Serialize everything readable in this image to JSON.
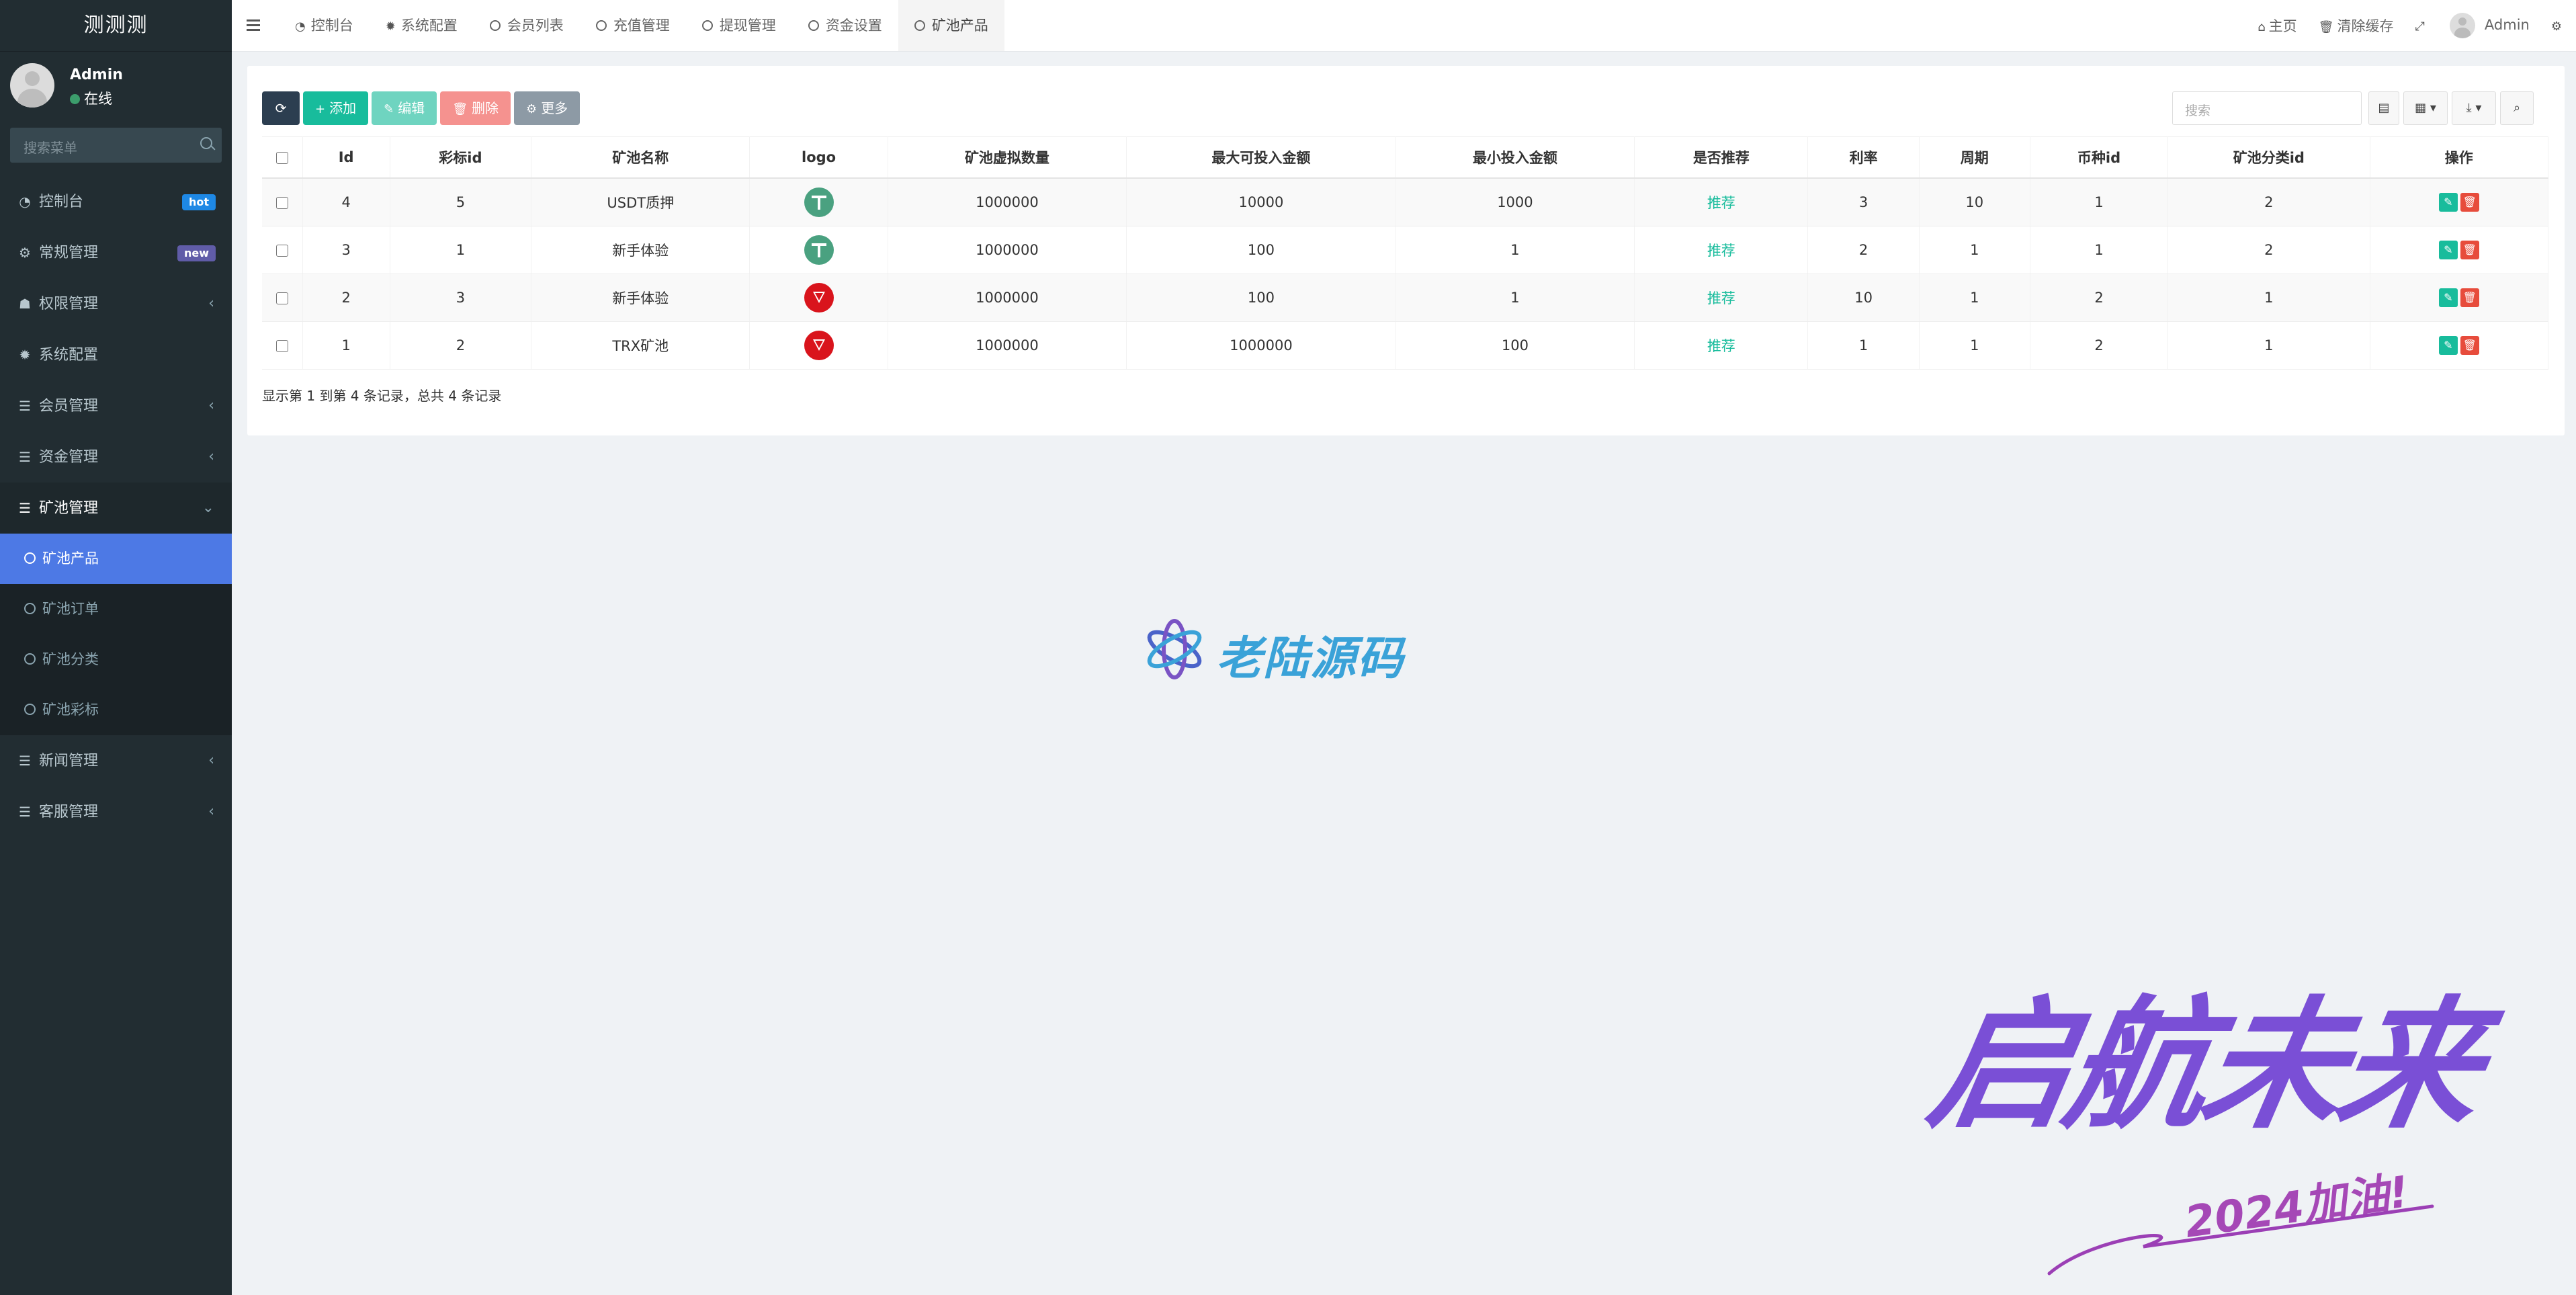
{
  "app": {
    "title": "测测测"
  },
  "user": {
    "name": "Admin",
    "status": "在线"
  },
  "sidebar": {
    "search_placeholder": "搜索菜单",
    "items": [
      {
        "label": "控制台",
        "icon": "dashboard-icon",
        "badge": "hot",
        "badge_color": "#1e88e5"
      },
      {
        "label": "常规管理",
        "icon": "cogs-icon",
        "badge": "new",
        "badge_color": "#605ca8"
      },
      {
        "label": "权限管理",
        "icon": "group-icon",
        "caret": "‹"
      },
      {
        "label": "系统配置",
        "icon": "gear-icon"
      },
      {
        "label": "会员管理",
        "icon": "list-icon",
        "caret": "‹"
      },
      {
        "label": "资金管理",
        "icon": "list-icon",
        "caret": "‹"
      },
      {
        "label": "矿池管理",
        "icon": "list-icon",
        "caret": "⌄",
        "open": true,
        "children": [
          {
            "label": "矿池产品",
            "active": true
          },
          {
            "label": "矿池订单"
          },
          {
            "label": "矿池分类"
          },
          {
            "label": "矿池彩标"
          }
        ]
      },
      {
        "label": "新闻管理",
        "icon": "list-icon",
        "caret": "‹"
      },
      {
        "label": "客服管理",
        "icon": "list-icon",
        "caret": "‹"
      }
    ]
  },
  "topbar": {
    "tabs": [
      {
        "label": "控制台",
        "icon": "dashboard-icon"
      },
      {
        "label": "系统配置",
        "icon": "gear-icon"
      },
      {
        "label": "会员列表",
        "icon": "circle-icon"
      },
      {
        "label": "充值管理",
        "icon": "circle-icon"
      },
      {
        "label": "提现管理",
        "icon": "circle-icon"
      },
      {
        "label": "资金设置",
        "icon": "circle-icon"
      },
      {
        "label": "矿池产品",
        "icon": "circle-icon",
        "active": true
      }
    ],
    "home": "主页",
    "clear_cache": "清除缓存",
    "user": "Admin"
  },
  "toolbar": {
    "add": "添加",
    "edit": "编辑",
    "delete": "删除",
    "more": "更多",
    "search_placeholder": "搜索"
  },
  "table": {
    "columns": [
      "Id",
      "彩标id",
      "矿池名称",
      "logo",
      "矿池虚拟数量",
      "最大可投入金额",
      "最小投入金额",
      "是否推荐",
      "利率",
      "周期",
      "币种id",
      "矿池分类id",
      "操作"
    ],
    "rows": [
      {
        "id": "4",
        "tag_id": "5",
        "name": "USDT质押",
        "logo": "usdt",
        "virtual_qty": "1000000",
        "max_invest": "10000",
        "min_invest": "1000",
        "recommend": "推荐",
        "rate": "3",
        "period": "10",
        "currency_id": "1",
        "category_id": "2"
      },
      {
        "id": "3",
        "tag_id": "1",
        "name": "新手体验",
        "logo": "usdt",
        "virtual_qty": "1000000",
        "max_invest": "100",
        "min_invest": "1",
        "recommend": "推荐",
        "rate": "2",
        "period": "1",
        "currency_id": "1",
        "category_id": "2"
      },
      {
        "id": "2",
        "tag_id": "3",
        "name": "新手体验",
        "logo": "trx",
        "virtual_qty": "1000000",
        "max_invest": "100",
        "min_invest": "1",
        "recommend": "推荐",
        "rate": "10",
        "period": "1",
        "currency_id": "2",
        "category_id": "1"
      },
      {
        "id": "1",
        "tag_id": "2",
        "name": "TRX矿池",
        "logo": "trx",
        "virtual_qty": "1000000",
        "max_invest": "1000000",
        "min_invest": "100",
        "recommend": "推荐",
        "rate": "1",
        "period": "1",
        "currency_id": "2",
        "category_id": "1"
      }
    ],
    "summary": "显示第 1 到第 4 条记录，总共 4 条记录"
  },
  "watermarks": {
    "logo_text": "老陆源码",
    "slogan": "启航未来",
    "slogan_sub": "2024加油!"
  }
}
